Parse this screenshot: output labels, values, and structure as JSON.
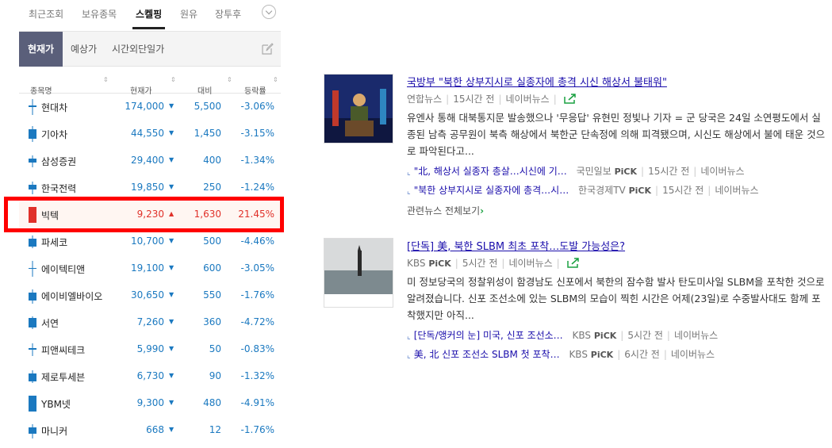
{
  "tabs": [
    "최근조회",
    "보유종목",
    "스켈핑",
    "원유",
    "장투후"
  ],
  "subtabs": [
    "현재가",
    "예상가",
    "시간외단일가"
  ],
  "columns": {
    "name": "종목명",
    "price": "현재가",
    "change": "대비",
    "rate": "등락률"
  },
  "rows": [
    {
      "name": "현대차",
      "price": "174,000",
      "change": "5,500",
      "rate": "-3.06%",
      "dir": "down"
    },
    {
      "name": "기아차",
      "price": "44,550",
      "change": "1,450",
      "rate": "-3.15%",
      "dir": "down"
    },
    {
      "name": "삼성증권",
      "price": "29,400",
      "change": "400",
      "rate": "-1.34%",
      "dir": "down"
    },
    {
      "name": "한국전력",
      "price": "19,850",
      "change": "250",
      "rate": "-1.24%",
      "dir": "down"
    },
    {
      "name": "빅텍",
      "price": "9,230",
      "change": "1,630",
      "rate": "21.45%",
      "dir": "up"
    },
    {
      "name": "파세코",
      "price": "10,700",
      "change": "500",
      "rate": "-4.46%",
      "dir": "down"
    },
    {
      "name": "에이텍티앤",
      "price": "19,100",
      "change": "600",
      "rate": "-3.05%",
      "dir": "down"
    },
    {
      "name": "에이비엘바이오",
      "price": "30,650",
      "change": "550",
      "rate": "-1.76%",
      "dir": "down"
    },
    {
      "name": "서연",
      "price": "7,260",
      "change": "360",
      "rate": "-4.72%",
      "dir": "down"
    },
    {
      "name": "피앤씨테크",
      "price": "5,990",
      "change": "50",
      "rate": "-0.83%",
      "dir": "down"
    },
    {
      "name": "제로투세븐",
      "price": "6,730",
      "change": "90",
      "rate": "-1.32%",
      "dir": "down"
    },
    {
      "name": "YBM넷",
      "price": "9,300",
      "change": "480",
      "rate": "-4.91%",
      "dir": "down"
    },
    {
      "name": "마니커",
      "price": "668",
      "change": "12",
      "rate": "-1.76%",
      "dir": "down"
    }
  ],
  "colors": {
    "down": "#1b79c0",
    "up": "#e0312a",
    "highlight": "#ff0000"
  },
  "news": [
    {
      "title": "국방부 \"북한 상부지시로 실종자에 총격 시신 해상서 불태워\"",
      "source": "연합뉴스",
      "time": "15시간 전",
      "portal": "네이버뉴스",
      "desc": "유엔사 통해 대북통지문 발송했으나 '무응답' 유현민 정빛나 기자 = 군 당국은 24일 소연평도에서 실종된 남측 공무원이 북측 해상에서 북한군 단속정에 의해 피격됐으며, 시신도 해상에서 불에 태운 것으로 파악된다고...",
      "related": [
        {
          "title": "\"北, 해상서 실종자 총살…시신에 기…",
          "source": "국민일보",
          "pick": "PiCK",
          "time": "15시간 전",
          "portal": "네이버뉴스"
        },
        {
          "title": "\"북한 상부지시로 실종자에 총격…시…",
          "source": "한국경제TV",
          "pick": "PiCK",
          "time": "15시간 전",
          "portal": "네이버뉴스"
        }
      ],
      "more": "관련뉴스 전체보기"
    },
    {
      "title": "[단독] 美, 북한 SLBM 최초 포착…도발 가능성은?",
      "source": "KBS",
      "pick": "PiCK",
      "time": "5시간 전",
      "portal": "네이버뉴스",
      "desc": "미 정보당국의 정찰위성이 함경남도 신포에서 북한의 잠수함 발사 탄도미사일 SLBM을 포착한 것으로 알려졌습니다. 신포 조선소에 있는 SLBM의 모습이 찍힌 시간은 어제(23일)로 수중발사대도 함께 포착했지만 아직...",
      "related": [
        {
          "title": "[단독/앵커의 눈] 미국, 신포 조선소…",
          "source": "KBS",
          "pick": "PiCK",
          "time": "5시간 전",
          "portal": "네이버뉴스"
        },
        {
          "title": "美, 北 신포 조선소 SLBM 첫 포착…",
          "source": "KBS",
          "pick": "PiCK",
          "time": "6시간 전",
          "portal": "네이버뉴스"
        }
      ]
    }
  ]
}
